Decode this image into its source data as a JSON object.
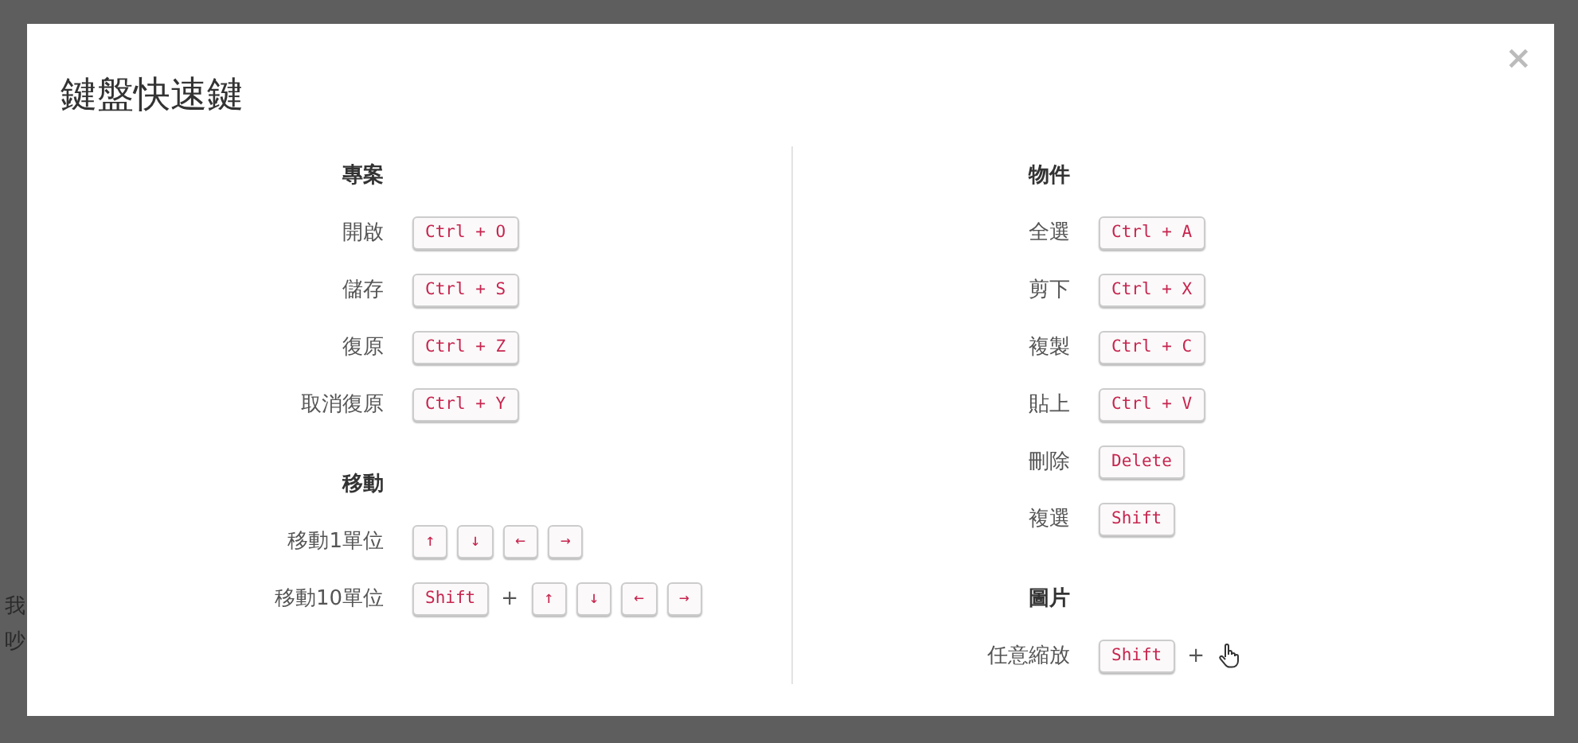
{
  "backdrop": {
    "texts": [
      "我",
      "吵"
    ]
  },
  "dialog": {
    "title": "鍵盤快速鍵",
    "close": "×",
    "columns": [
      {
        "sections": [
          {
            "title": "專案",
            "rows": [
              {
                "label": "開啟",
                "keys": [
                  {
                    "kind": "key",
                    "text": "Ctrl + O"
                  }
                ]
              },
              {
                "label": "儲存",
                "keys": [
                  {
                    "kind": "key",
                    "text": "Ctrl + S"
                  }
                ]
              },
              {
                "label": "復原",
                "keys": [
                  {
                    "kind": "key",
                    "text": "Ctrl + Z"
                  }
                ]
              },
              {
                "label": "取消復原",
                "keys": [
                  {
                    "kind": "key",
                    "text": "Ctrl + Y"
                  }
                ]
              }
            ]
          },
          {
            "title": "移動",
            "rows": [
              {
                "label": "移動1單位",
                "keys": [
                  {
                    "kind": "key",
                    "text": "↑"
                  },
                  {
                    "kind": "key",
                    "text": "↓"
                  },
                  {
                    "kind": "key",
                    "text": "←"
                  },
                  {
                    "kind": "key",
                    "text": "→"
                  }
                ]
              },
              {
                "label": "移動10單位",
                "keys": [
                  {
                    "kind": "key",
                    "text": "Shift"
                  },
                  {
                    "kind": "plus",
                    "text": "+"
                  },
                  {
                    "kind": "key",
                    "text": "↑"
                  },
                  {
                    "kind": "key",
                    "text": "↓"
                  },
                  {
                    "kind": "key",
                    "text": "←"
                  },
                  {
                    "kind": "key",
                    "text": "→"
                  }
                ]
              }
            ]
          }
        ]
      },
      {
        "sections": [
          {
            "title": "物件",
            "rows": [
              {
                "label": "全選",
                "keys": [
                  {
                    "kind": "key",
                    "text": "Ctrl + A"
                  }
                ]
              },
              {
                "label": "剪下",
                "keys": [
                  {
                    "kind": "key",
                    "text": "Ctrl + X"
                  }
                ]
              },
              {
                "label": "複製",
                "keys": [
                  {
                    "kind": "key",
                    "text": "Ctrl + C"
                  }
                ]
              },
              {
                "label": "貼上",
                "keys": [
                  {
                    "kind": "key",
                    "text": "Ctrl + V"
                  }
                ]
              },
              {
                "label": "刪除",
                "keys": [
                  {
                    "kind": "key",
                    "text": "Delete"
                  }
                ]
              },
              {
                "label": "複選",
                "keys": [
                  {
                    "kind": "key",
                    "text": "Shift"
                  }
                ]
              }
            ]
          },
          {
            "title": "圖片",
            "rows": [
              {
                "label": "任意縮放",
                "keys": [
                  {
                    "kind": "key",
                    "text": "Shift"
                  },
                  {
                    "kind": "plus",
                    "text": "+"
                  },
                  {
                    "kind": "mouse"
                  }
                ]
              }
            ]
          }
        ]
      }
    ]
  }
}
